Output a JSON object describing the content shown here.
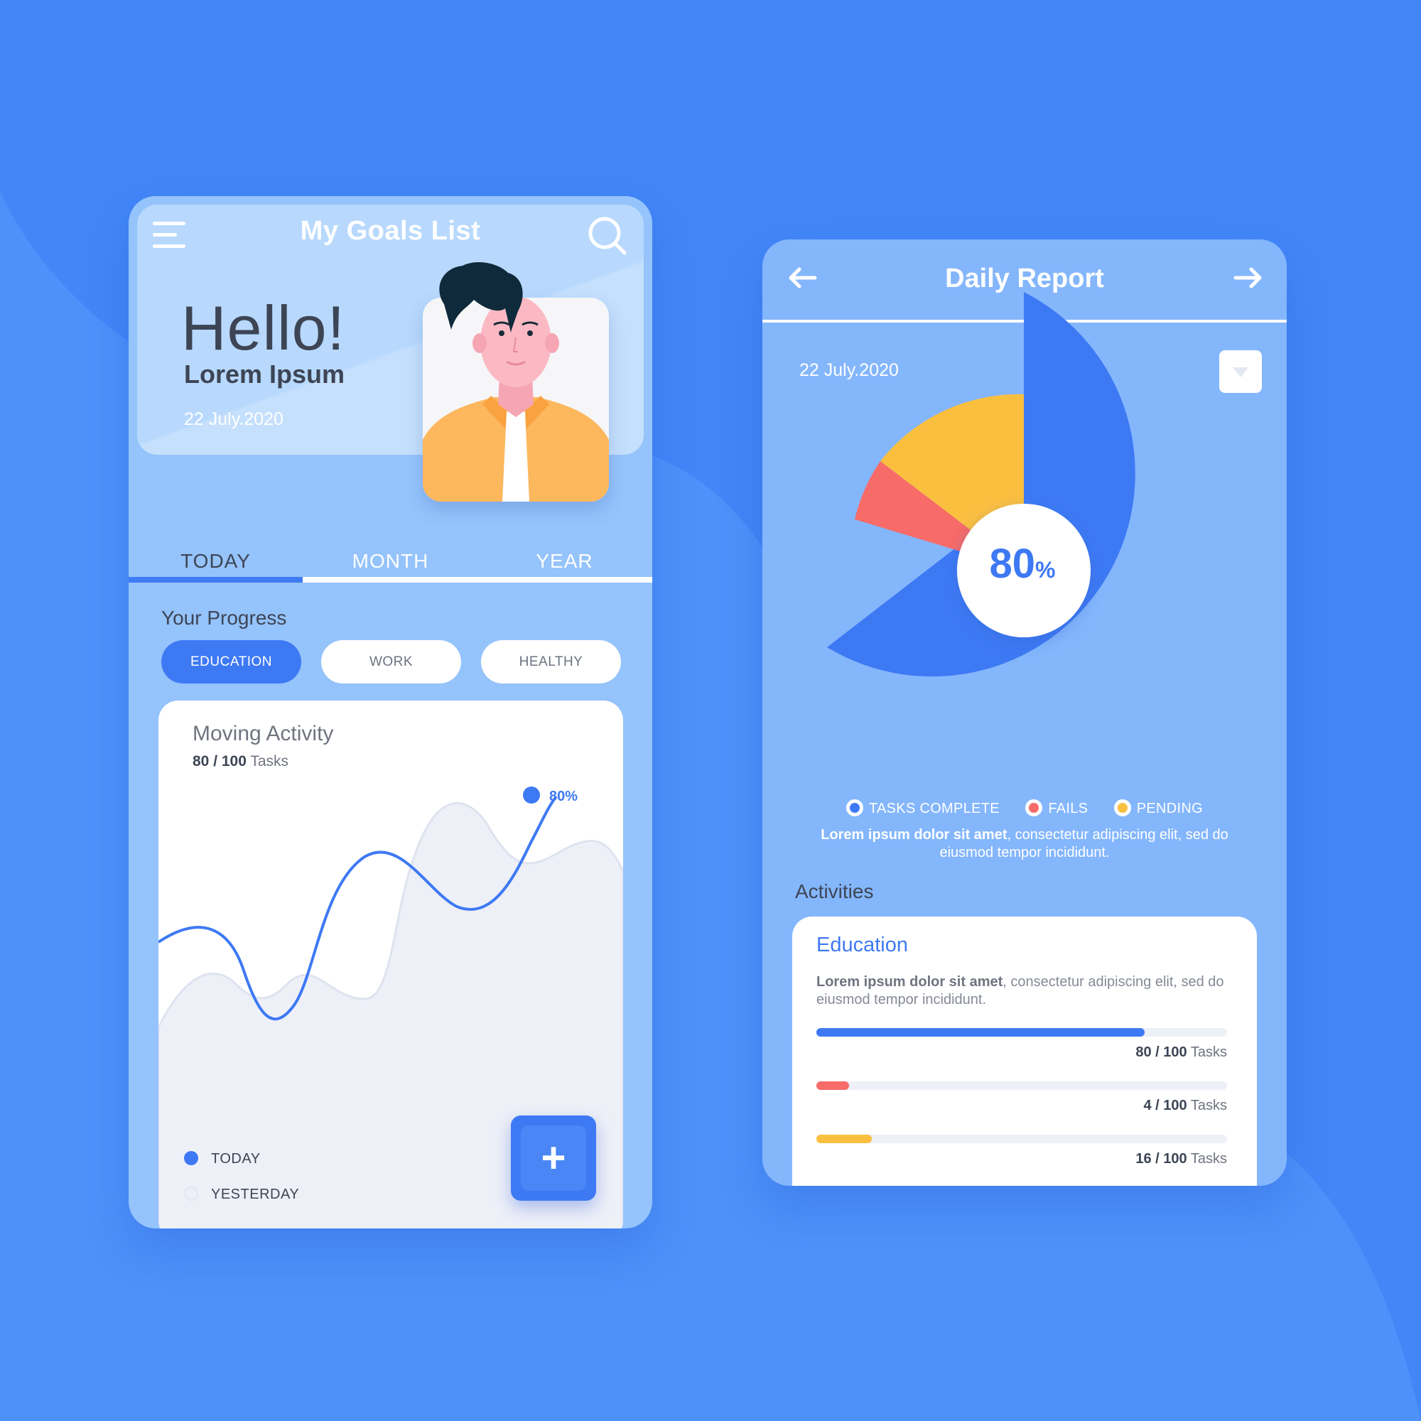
{
  "goals_screen": {
    "title": "My Goals List",
    "greeting": "Hello!",
    "user_name": "Lorem Ipsum",
    "date": "22 July.2020",
    "tabs": [
      {
        "label": "TODAY",
        "active": true
      },
      {
        "label": "MONTH",
        "active": false
      },
      {
        "label": "YEAR",
        "active": false
      }
    ],
    "progress_label": "Your Progress",
    "categories": [
      {
        "label": "EDUCATION",
        "active": true
      },
      {
        "label": "WORK",
        "active": false
      },
      {
        "label": "HEALTHY",
        "active": false
      }
    ],
    "activity_card": {
      "title": "Moving Activity",
      "tasks_done": "80 / 100",
      "tasks_unit": "Tasks",
      "point_label": "80%",
      "legend": [
        {
          "label": "TODAY",
          "color": "#3e79f4"
        },
        {
          "label": "YESTERDAY",
          "color": "#edf0f7"
        }
      ],
      "add_button": "+"
    }
  },
  "report_screen": {
    "title": "Daily Report",
    "date": "22 July.2020",
    "center_value": "80",
    "center_unit": "%",
    "legend": [
      {
        "label": "TASKS COMPLETE",
        "color": "#3e79f4"
      },
      {
        "label": "FAILS",
        "color": "#f76b68"
      },
      {
        "label": "PENDING",
        "color": "#fbbf40"
      }
    ],
    "description_bold": "Lorem ipsum dolor sit amet",
    "description_rest": ", consectetur adipiscing elit, sed do eiusmod tempor incididunt.",
    "activities_label": "Activities",
    "education_card": {
      "title": "Education",
      "description_bold": "Lorem ipsum dolor sit amet",
      "description_rest": ", consectetur adipiscing elit, sed do eiusmod tempor incididunt.",
      "bars": [
        {
          "value": "80 / 100",
          "unit": "Tasks",
          "fraction": 0.8,
          "color": "#3e79f4"
        },
        {
          "value": "4 / 100",
          "unit": "Tasks",
          "fraction": 0.08,
          "color": "#f76b68"
        },
        {
          "value": "16 / 100",
          "unit": "Tasks",
          "fraction": 0.135,
          "color": "#fbbf40"
        }
      ]
    }
  },
  "colors": {
    "background": "#4286f8",
    "accent": "#3e79f4",
    "fails": "#f76b68",
    "pending": "#fbbf40"
  },
  "icons": [
    "menu-icon",
    "search-icon",
    "arrow-left-icon",
    "arrow-right-icon",
    "dropdown-icon",
    "plus-icon"
  ]
}
